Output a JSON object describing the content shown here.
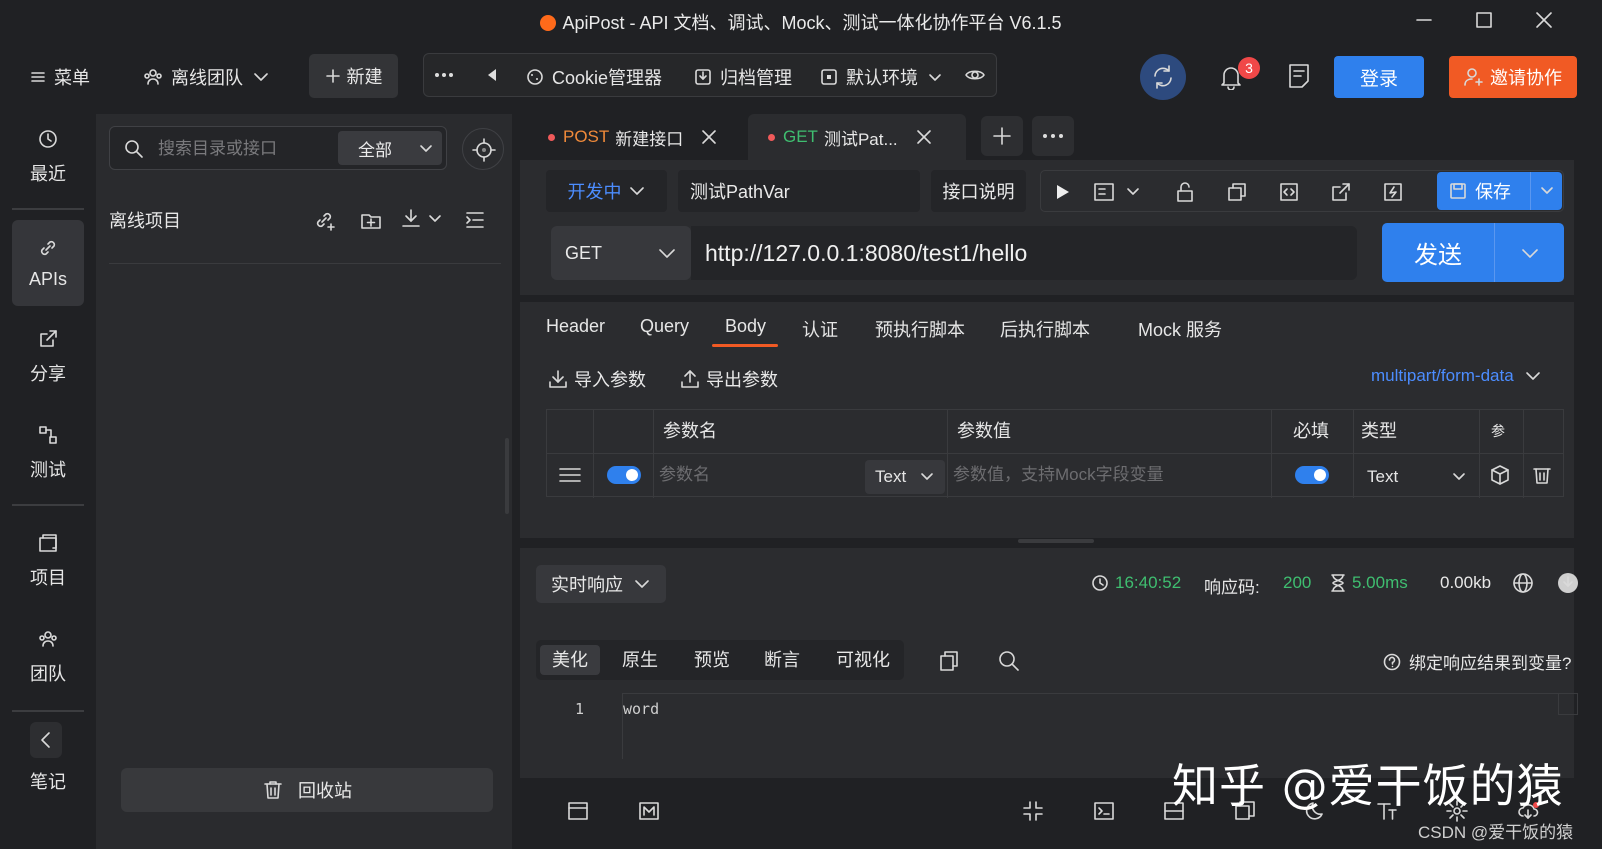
{
  "window": {
    "title": "ApiPost - API 文档、调试、Mock、测试一体化协作平台 V6.1.5"
  },
  "toolbar": {
    "menu_label": "菜单",
    "team_label": "离线团队",
    "new_label": "新建",
    "cookie_label": "Cookie管理器",
    "archive_label": "归档管理",
    "env_label": "默认环境",
    "notification_count": "3",
    "login_label": "登录",
    "invite_label": "邀请协作"
  },
  "leftnav": {
    "items": [
      {
        "label": "最近",
        "icon": "clock-icon"
      },
      {
        "label": "APIs",
        "icon": "link-icon"
      },
      {
        "label": "分享",
        "icon": "share-icon"
      },
      {
        "label": "测试",
        "icon": "flow-icon"
      },
      {
        "label": "项目",
        "icon": "project-icon"
      },
      {
        "label": "团队",
        "icon": "team-icon"
      },
      {
        "label": "笔记",
        "icon": "note-icon"
      }
    ]
  },
  "sidebar": {
    "search_placeholder": "搜索目录或接口",
    "scope": "全部",
    "project_title": "离线项目",
    "trash_label": "回收站"
  },
  "tabs": [
    {
      "method": "POST",
      "name": "新建接口",
      "method_color": "#f08a3a"
    },
    {
      "method": "GET",
      "name": "测试Pat...",
      "method_color": "#3fbe70"
    }
  ],
  "request": {
    "status": "开发中",
    "name": "测试PathVar",
    "desc_label": "接口说明",
    "save_label": "保存",
    "method": "GET",
    "url": "http://127.0.0.1:8080/test1/hello",
    "send_label": "发送"
  },
  "params": {
    "tabs": [
      "Header",
      "Query",
      "Body",
      "认证",
      "预执行脚本",
      "后执行脚本",
      "Mock 服务"
    ],
    "active_tab": "Body",
    "import_label": "导入参数",
    "export_label": "导出参数",
    "content_type": "multipart/form-data",
    "columns": {
      "name": "参数名",
      "value": "参数值",
      "required": "必填",
      "type": "类型",
      "desc": "参"
    },
    "row": {
      "name_placeholder": "参数名",
      "field_type": "Text",
      "value_placeholder": "参数值，支持Mock字段变量",
      "type": "Text"
    }
  },
  "response": {
    "mode": "实时响应",
    "time": "16:40:52",
    "code_label": "响应码:",
    "code": "200",
    "duration": "5.00ms",
    "size": "0.00kb",
    "view_tabs": [
      "美化",
      "原生",
      "预览",
      "断言",
      "可视化"
    ],
    "active_view": "美化",
    "bind_label": "绑定响应结果到变量?",
    "line_number": "1",
    "body": "word"
  },
  "watermark": {
    "main": "知乎 @爱干饭的猿",
    "sub": "CSDN @爱干饭的猿"
  },
  "colors": {
    "accent": "#2f80ed",
    "brand_orange": "#f15a24",
    "success": "#3fbe70"
  }
}
